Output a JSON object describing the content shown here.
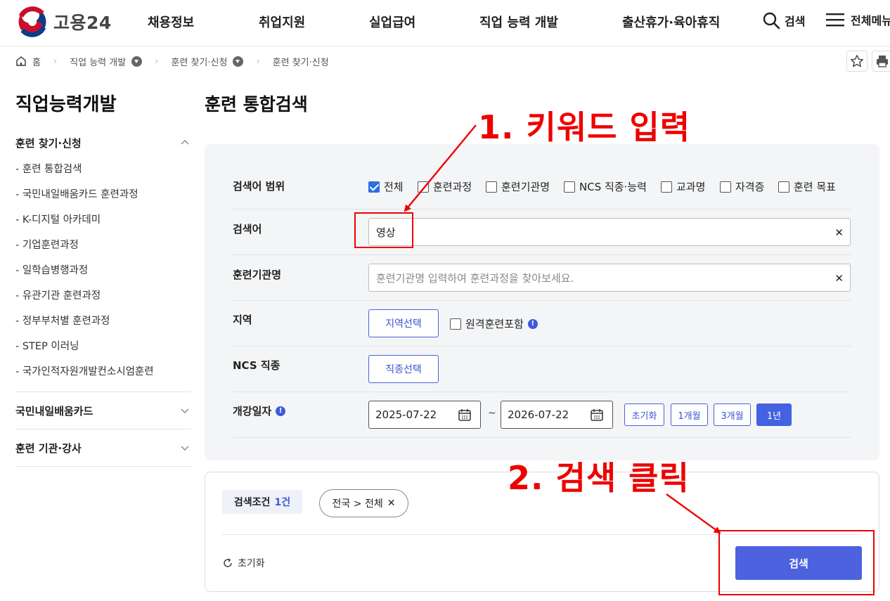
{
  "header": {
    "logo_text": "고용24",
    "nav": [
      "채용정보",
      "취업지원",
      "실업급여",
      "직업 능력 개발",
      "출산휴가·육아휴직"
    ],
    "search_label": "검색",
    "menu_label": "전체메뉴"
  },
  "breadcrumb": {
    "home": "홈",
    "items": [
      "직업 능력 개발",
      "훈련 찾기·신청",
      "훈련 찾기·신청"
    ]
  },
  "sidebar": {
    "title": "직업능력개발",
    "groups": [
      {
        "label": "훈련 찾기·신청",
        "expanded": true,
        "items": [
          "- 훈련 통합검색",
          "- 국민내일배움카드 훈련과정",
          "- K-디지털 아카데미",
          "- 기업훈련과정",
          "- 일학습병행과정",
          "- 유관기관 훈련과정",
          "- 정부부처별 훈련과정",
          "- STEP 이러닝",
          "- 국가인적자원개발컨소시엄훈련"
        ]
      },
      {
        "label": "국민내일배움카드",
        "expanded": false
      },
      {
        "label": "훈련 기관·강사",
        "expanded": false
      }
    ]
  },
  "main": {
    "title": "훈련 통합검색",
    "scope": {
      "label": "검색어 범위",
      "options": [
        {
          "label": "전체",
          "checked": true
        },
        {
          "label": "훈련과정",
          "checked": false
        },
        {
          "label": "훈련기관명",
          "checked": false
        },
        {
          "label": "NCS 직종·능력",
          "checked": false
        },
        {
          "label": "교과명",
          "checked": false
        },
        {
          "label": "자격증",
          "checked": false
        },
        {
          "label": "훈련 목표",
          "checked": false
        }
      ]
    },
    "keyword": {
      "label": "검색어",
      "value": "영상"
    },
    "institution": {
      "label": "훈련기관명",
      "placeholder": "훈련기관명 입력하여 훈련과정을 찾아보세요."
    },
    "region": {
      "label": "지역",
      "button": "지역선택",
      "remote_label": "원격훈련포함"
    },
    "ncs": {
      "label": "NCS 직종",
      "button": "직종선택"
    },
    "date": {
      "label": "개강일자",
      "start": "2025-07-22",
      "sep": "~",
      "end": "2026-07-22",
      "buttons": [
        "초기화",
        "1개월",
        "3개월",
        "1년"
      ],
      "active": "1년"
    },
    "conditions": {
      "label": "검색조건",
      "count": "1건",
      "chip": "전국 > 전체"
    },
    "reset_label": "초기화",
    "search_button": "검색"
  },
  "annotations": {
    "step1": "1. 키워드 입력",
    "step2": "2. 검색 클릭"
  },
  "colors": {
    "accent": "#4c62df",
    "annotation": "#ee0000"
  }
}
